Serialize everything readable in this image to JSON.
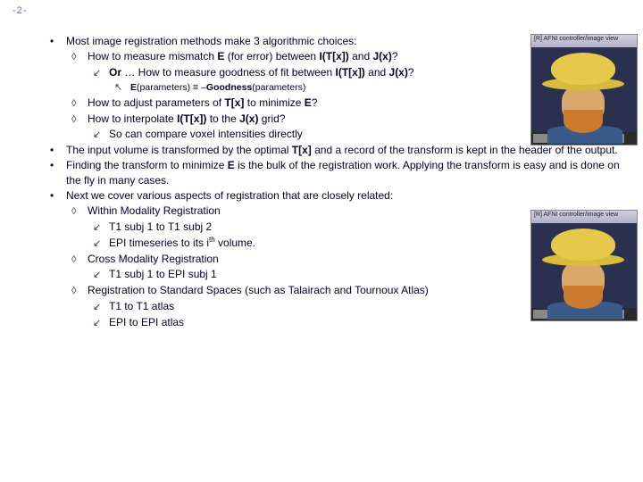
{
  "page_number": "-2-",
  "lines": [
    {
      "lvl": 0,
      "mk": "dot",
      "segs": [
        {
          "t": "Most image registration methods make 3 algorithmic choices:"
        }
      ]
    },
    {
      "lvl": 1,
      "mk": "diamond",
      "segs": [
        {
          "t": "How to measure mismatch "
        },
        {
          "t": "E",
          "b": true
        },
        {
          "t": " (for error) between "
        },
        {
          "t": "I(T[x])",
          "b": true
        },
        {
          "t": " and "
        },
        {
          "t": "J(x)",
          "b": true
        },
        {
          "t": "?"
        }
      ]
    },
    {
      "lvl": 2,
      "mk": "arrow",
      "segs": [
        {
          "t": "Or",
          "b": true
        },
        {
          "t": " … How to measure goodness of fit between "
        },
        {
          "t": "I(T[x])",
          "b": true
        },
        {
          "t": " and "
        },
        {
          "t": "J(x)",
          "b": true
        },
        {
          "t": "?"
        }
      ]
    },
    {
      "lvl": 3,
      "mk": "uparrow",
      "cls": "small",
      "segs": [
        {
          "t": "E",
          "b": true
        },
        {
          "t": "(parameters) ≡ –"
        },
        {
          "t": "Goodness",
          "b": true
        },
        {
          "t": "(parameters)"
        }
      ]
    },
    {
      "lvl": 1,
      "mk": "diamond",
      "segs": [
        {
          "t": "How to adjust parameters of "
        },
        {
          "t": "T[x]",
          "b": true
        },
        {
          "t": " to minimize "
        },
        {
          "t": "E",
          "b": true
        },
        {
          "t": "?"
        }
      ]
    },
    {
      "lvl": 1,
      "mk": "diamond",
      "segs": [
        {
          "t": "How to interpolate "
        },
        {
          "t": "I(T[x])",
          "b": true
        },
        {
          "t": " to the "
        },
        {
          "t": "J(x)",
          "b": true
        },
        {
          "t": " grid?"
        }
      ]
    },
    {
      "lvl": 2,
      "mk": "arrow",
      "segs": [
        {
          "t": "So can compare voxel intensities directly"
        }
      ]
    },
    {
      "lvl": 0,
      "mk": "dot",
      "full": true,
      "segs": [
        {
          "t": "The input volume is transformed by the optimal "
        },
        {
          "t": "T[x]",
          "b": true
        },
        {
          "t": " and a record of the transform is kept in the header of the output."
        }
      ]
    },
    {
      "lvl": 0,
      "mk": "dot",
      "full": true,
      "segs": [
        {
          "t": "Finding the transform to minimize "
        },
        {
          "t": "E",
          "b": true
        },
        {
          "t": " is the bulk of the registration work. Applying the transform is easy and is done on the fly in many cases."
        }
      ]
    },
    {
      "lvl": 0,
      "mk": "dot",
      "segs": [
        {
          "t": "Next we cover various aspects of registration that are closely related:"
        }
      ]
    },
    {
      "lvl": 1,
      "mk": "diamond",
      "segs": [
        {
          "t": "Within Modality Registration"
        }
      ]
    },
    {
      "lvl": 2,
      "mk": "arrow",
      "segs": [
        {
          "t": "T1 subj 1 to T1 subj 2"
        }
      ]
    },
    {
      "lvl": 2,
      "mk": "arrow",
      "segs": [
        {
          "t": "EPI timeseries to its i"
        },
        {
          "t": "th",
          "sup": true
        },
        {
          "t": " volume."
        }
      ]
    },
    {
      "lvl": 1,
      "mk": "diamond",
      "segs": [
        {
          "t": "Cross Modality Registration"
        }
      ]
    },
    {
      "lvl": 2,
      "mk": "arrow",
      "segs": [
        {
          "t": "T1 subj 1 to EPI subj 1"
        }
      ]
    },
    {
      "lvl": 1,
      "mk": "diamond",
      "segs": [
        {
          "t": "Registration to Standard Spaces (such as Talairach and Tournoux Atlas)"
        }
      ]
    },
    {
      "lvl": 2,
      "mk": "arrow",
      "segs": [
        {
          "t": "T1 to T1 atlas"
        }
      ]
    },
    {
      "lvl": 2,
      "mk": "arrow",
      "segs": [
        {
          "t": "EPI to EPI atlas"
        }
      ]
    }
  ],
  "image_caption_top": "[R] AFNI controller/image view",
  "image_caption_bot": "[R] AFNI controller/image view"
}
